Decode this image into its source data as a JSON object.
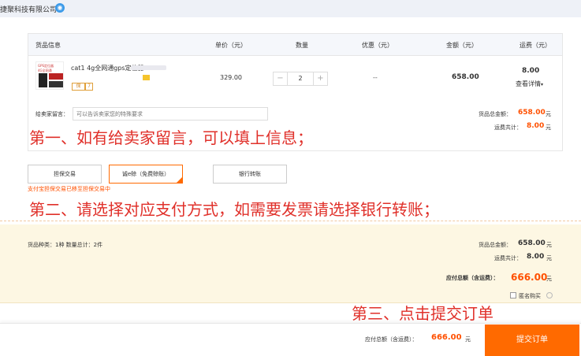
{
  "header": {
    "company": "捷聚科技有限公司",
    "ww_icon": "aliwangwang-chat-icon"
  },
  "table": {
    "columns": [
      "货品信息",
      "单价（元）",
      "数量",
      "优惠（元）",
      "金额（元）",
      "运费（元）"
    ]
  },
  "item": {
    "title": "cat1 4g全网通gps定位器",
    "thumb_text_1": "GPS定位器",
    "thumb_text_2": "4G全网通",
    "badge_1": "保",
    "badge_2": "7",
    "price": "329.00",
    "quantity": "2",
    "minus": "−",
    "plus": "+",
    "discount": "--",
    "amount": "658.00",
    "shipping": "8.00",
    "shipping_details": "查看详情",
    "caret": "▾"
  },
  "message": {
    "label": "给卖家留言：",
    "placeholder": "可以告诉卖家您的特殊要求"
  },
  "order_summary": {
    "goods_label": "货品总金额：",
    "goods_value": "658.00",
    "ship_label": "运费共计：",
    "ship_value": "8.00",
    "unit": "元"
  },
  "annotations": {
    "step1": "第一、如有给卖家留言，可以填上信息；",
    "step2": "第二、请选择对应支付方式，如需要发票请选择银行转账；",
    "step3": "第三、点击提交订单"
  },
  "payment": {
    "options": [
      "担保交易",
      "诚e赊（免费赊账）",
      "银行转账"
    ],
    "selected_index": 1,
    "notice": "支付宝担保交易已移至担保交易中"
  },
  "summary": {
    "left_text": "货品种类：1种   数量总计：2件",
    "goods_label": "货品总金额：",
    "goods_value": "658.00",
    "ship_label": "运费共计：",
    "ship_value": "8.00",
    "total_label": "应付总额（含运费）：",
    "total_value": "666.00",
    "unit": "元",
    "anonymous_label": "匿名购买"
  },
  "footer": {
    "label": "应付总额（含运费）：",
    "value": "666.00",
    "unit": "元",
    "submit": "提交订单"
  },
  "colors": {
    "accent": "#ff6a00",
    "price_orange": "#ff5000",
    "annotation_red": "#e0302a",
    "summary_bg": "#fdf7e3"
  }
}
